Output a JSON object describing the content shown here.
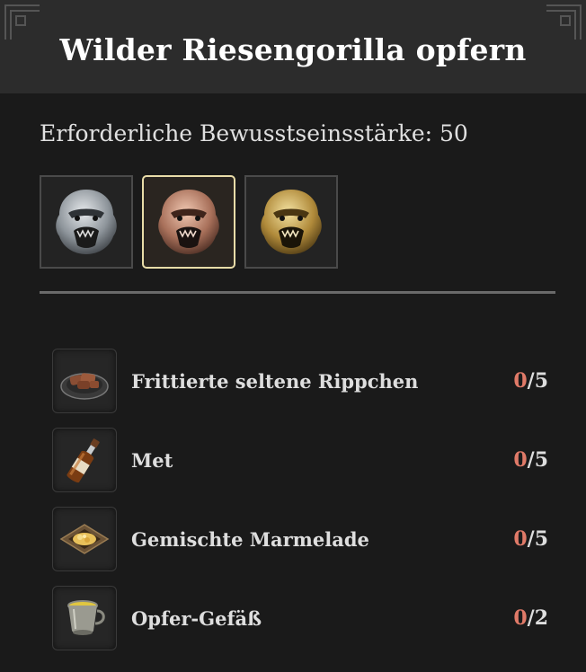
{
  "header": {
    "title": "Wilder Riesengorilla opfern"
  },
  "requirement": {
    "text": "Erforderliche Bewusstseinsstärke: 50"
  },
  "offering_tiers": [
    {
      "name": "silver",
      "color": "#9aa0a6",
      "selected": false
    },
    {
      "name": "bronze",
      "color": "#b07a60",
      "selected": true
    },
    {
      "name": "gold",
      "color": "#b8963f",
      "selected": false
    }
  ],
  "materials": [
    {
      "name": "Frittierte seltene Rippchen",
      "have": "0",
      "sep": "/",
      "need": "5",
      "icon": "ribs-plate-icon"
    },
    {
      "name": "Met",
      "have": "0",
      "sep": "/",
      "need": "5",
      "icon": "bottle-icon"
    },
    {
      "name": "Gemischte Marmelade",
      "have": "0",
      "sep": "/",
      "need": "5",
      "icon": "jam-tray-icon"
    },
    {
      "name": "Opfer-Gefäß",
      "have": "0",
      "sep": "/",
      "need": "2",
      "icon": "cup-icon"
    }
  ],
  "colors": {
    "missing_count": "#e07a68",
    "selected_border": "#e8dca8"
  }
}
